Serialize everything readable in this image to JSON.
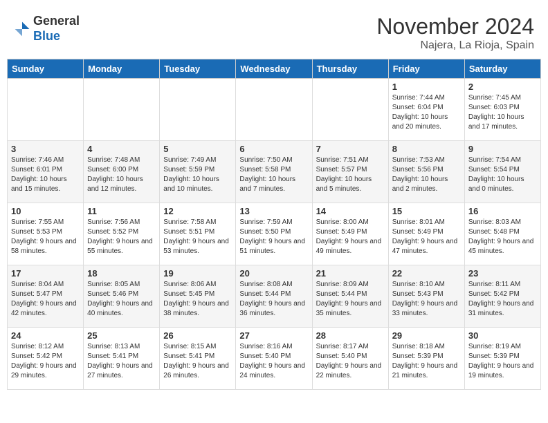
{
  "header": {
    "logo_line1": "General",
    "logo_line2": "Blue",
    "month_title": "November 2024",
    "location": "Najera, La Rioja, Spain"
  },
  "days_of_week": [
    "Sunday",
    "Monday",
    "Tuesday",
    "Wednesday",
    "Thursday",
    "Friday",
    "Saturday"
  ],
  "weeks": [
    [
      {
        "day": "",
        "info": ""
      },
      {
        "day": "",
        "info": ""
      },
      {
        "day": "",
        "info": ""
      },
      {
        "day": "",
        "info": ""
      },
      {
        "day": "",
        "info": ""
      },
      {
        "day": "1",
        "info": "Sunrise: 7:44 AM\nSunset: 6:04 PM\nDaylight: 10 hours and 20 minutes."
      },
      {
        "day": "2",
        "info": "Sunrise: 7:45 AM\nSunset: 6:03 PM\nDaylight: 10 hours and 17 minutes."
      }
    ],
    [
      {
        "day": "3",
        "info": "Sunrise: 7:46 AM\nSunset: 6:01 PM\nDaylight: 10 hours and 15 minutes."
      },
      {
        "day": "4",
        "info": "Sunrise: 7:48 AM\nSunset: 6:00 PM\nDaylight: 10 hours and 12 minutes."
      },
      {
        "day": "5",
        "info": "Sunrise: 7:49 AM\nSunset: 5:59 PM\nDaylight: 10 hours and 10 minutes."
      },
      {
        "day": "6",
        "info": "Sunrise: 7:50 AM\nSunset: 5:58 PM\nDaylight: 10 hours and 7 minutes."
      },
      {
        "day": "7",
        "info": "Sunrise: 7:51 AM\nSunset: 5:57 PM\nDaylight: 10 hours and 5 minutes."
      },
      {
        "day": "8",
        "info": "Sunrise: 7:53 AM\nSunset: 5:56 PM\nDaylight: 10 hours and 2 minutes."
      },
      {
        "day": "9",
        "info": "Sunrise: 7:54 AM\nSunset: 5:54 PM\nDaylight: 10 hours and 0 minutes."
      }
    ],
    [
      {
        "day": "10",
        "info": "Sunrise: 7:55 AM\nSunset: 5:53 PM\nDaylight: 9 hours and 58 minutes."
      },
      {
        "day": "11",
        "info": "Sunrise: 7:56 AM\nSunset: 5:52 PM\nDaylight: 9 hours and 55 minutes."
      },
      {
        "day": "12",
        "info": "Sunrise: 7:58 AM\nSunset: 5:51 PM\nDaylight: 9 hours and 53 minutes."
      },
      {
        "day": "13",
        "info": "Sunrise: 7:59 AM\nSunset: 5:50 PM\nDaylight: 9 hours and 51 minutes."
      },
      {
        "day": "14",
        "info": "Sunrise: 8:00 AM\nSunset: 5:49 PM\nDaylight: 9 hours and 49 minutes."
      },
      {
        "day": "15",
        "info": "Sunrise: 8:01 AM\nSunset: 5:49 PM\nDaylight: 9 hours and 47 minutes."
      },
      {
        "day": "16",
        "info": "Sunrise: 8:03 AM\nSunset: 5:48 PM\nDaylight: 9 hours and 45 minutes."
      }
    ],
    [
      {
        "day": "17",
        "info": "Sunrise: 8:04 AM\nSunset: 5:47 PM\nDaylight: 9 hours and 42 minutes."
      },
      {
        "day": "18",
        "info": "Sunrise: 8:05 AM\nSunset: 5:46 PM\nDaylight: 9 hours and 40 minutes."
      },
      {
        "day": "19",
        "info": "Sunrise: 8:06 AM\nSunset: 5:45 PM\nDaylight: 9 hours and 38 minutes."
      },
      {
        "day": "20",
        "info": "Sunrise: 8:08 AM\nSunset: 5:44 PM\nDaylight: 9 hours and 36 minutes."
      },
      {
        "day": "21",
        "info": "Sunrise: 8:09 AM\nSunset: 5:44 PM\nDaylight: 9 hours and 35 minutes."
      },
      {
        "day": "22",
        "info": "Sunrise: 8:10 AM\nSunset: 5:43 PM\nDaylight: 9 hours and 33 minutes."
      },
      {
        "day": "23",
        "info": "Sunrise: 8:11 AM\nSunset: 5:42 PM\nDaylight: 9 hours and 31 minutes."
      }
    ],
    [
      {
        "day": "24",
        "info": "Sunrise: 8:12 AM\nSunset: 5:42 PM\nDaylight: 9 hours and 29 minutes."
      },
      {
        "day": "25",
        "info": "Sunrise: 8:13 AM\nSunset: 5:41 PM\nDaylight: 9 hours and 27 minutes."
      },
      {
        "day": "26",
        "info": "Sunrise: 8:15 AM\nSunset: 5:41 PM\nDaylight: 9 hours and 26 minutes."
      },
      {
        "day": "27",
        "info": "Sunrise: 8:16 AM\nSunset: 5:40 PM\nDaylight: 9 hours and 24 minutes."
      },
      {
        "day": "28",
        "info": "Sunrise: 8:17 AM\nSunset: 5:40 PM\nDaylight: 9 hours and 22 minutes."
      },
      {
        "day": "29",
        "info": "Sunrise: 8:18 AM\nSunset: 5:39 PM\nDaylight: 9 hours and 21 minutes."
      },
      {
        "day": "30",
        "info": "Sunrise: 8:19 AM\nSunset: 5:39 PM\nDaylight: 9 hours and 19 minutes."
      }
    ]
  ]
}
